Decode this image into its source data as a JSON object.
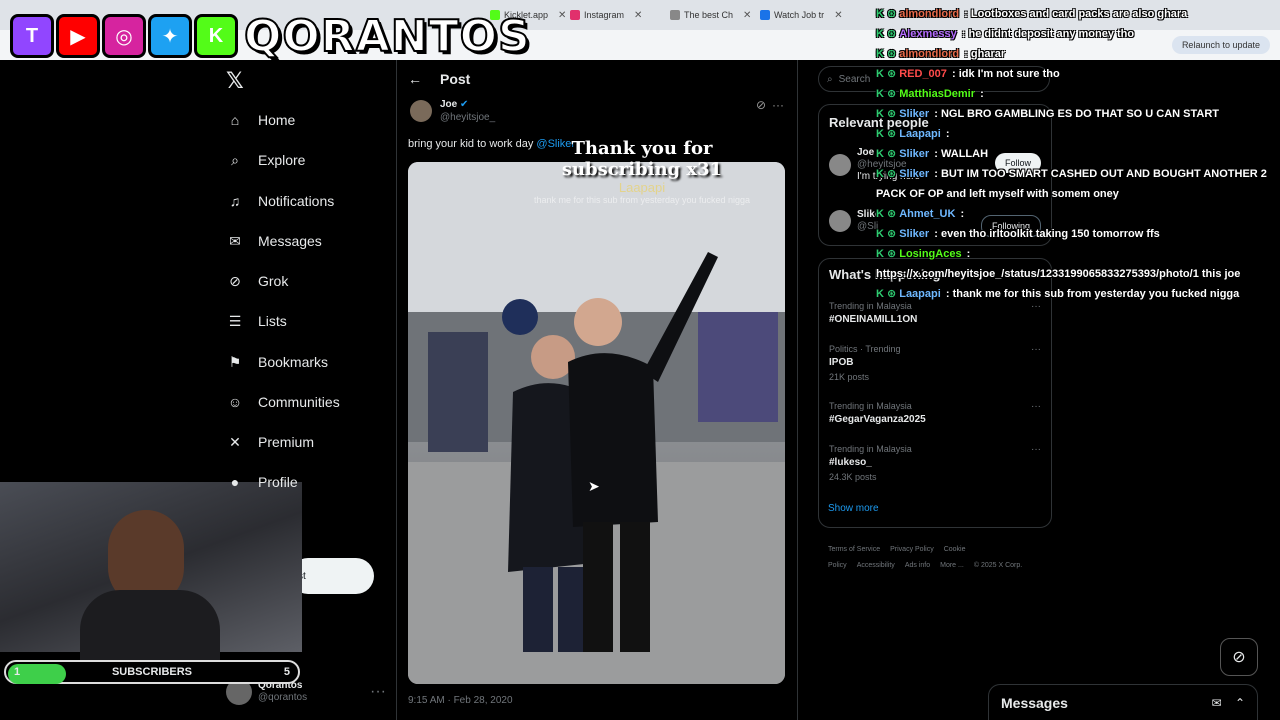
{
  "browser": {
    "tabs": [
      {
        "label": "Kicklet.app",
        "icon": "kick-icon",
        "color": "#53fc18"
      },
      {
        "label": "Instagram",
        "icon": "instagram-icon",
        "color": "#e1306c"
      },
      {
        "label": "The best Ch",
        "icon": "page-icon",
        "color": "#888888"
      },
      {
        "label": "Watch Job tr",
        "icon": "page-icon",
        "color": "#1a73e8"
      }
    ],
    "relaunch_label": "Relaunch to update"
  },
  "overlay": {
    "brand": "QORANTOS",
    "socials": [
      {
        "icon": "twitch-icon",
        "color": "#9146ff",
        "glyph": "T"
      },
      {
        "icon": "youtube-icon",
        "color": "#ff0000",
        "glyph": "▶"
      },
      {
        "icon": "instagram-icon",
        "color": "#d6249f",
        "glyph": "◎"
      },
      {
        "icon": "twitter-bird-icon",
        "color": "#1da1f2",
        "glyph": "✦"
      },
      {
        "icon": "kick-icon",
        "color": "#53fc18",
        "glyph": "K"
      }
    ]
  },
  "nav": {
    "items": [
      {
        "label": "Home",
        "icon": "home-icon",
        "glyph": "⌂"
      },
      {
        "label": "Explore",
        "icon": "search-icon",
        "glyph": "⌕"
      },
      {
        "label": "Notifications",
        "icon": "bell-icon",
        "glyph": "♫"
      },
      {
        "label": "Messages",
        "icon": "mail-icon",
        "glyph": "✉"
      },
      {
        "label": "Grok",
        "icon": "grok-icon",
        "glyph": "⊘"
      },
      {
        "label": "Lists",
        "icon": "list-icon",
        "glyph": "☰"
      },
      {
        "label": "Bookmarks",
        "icon": "bookmark-icon",
        "glyph": "⚑"
      },
      {
        "label": "Communities",
        "icon": "communities-icon",
        "glyph": "☺"
      },
      {
        "label": "Premium",
        "icon": "x-icon",
        "glyph": "✕"
      },
      {
        "label": "Profile",
        "icon": "profile-icon",
        "glyph": "●"
      }
    ],
    "post_button": "st",
    "account": {
      "name": "Qorantos",
      "handle": "@qorantos"
    }
  },
  "post": {
    "header": "Post",
    "author": {
      "name": "Joe",
      "handle": "@heyitsjoe_"
    },
    "text": "bring your kid to work day",
    "mention": "@Sliker",
    "timestamp": "9:15 AM · Feb 28, 2020"
  },
  "sidebar": {
    "search_placeholder": "Search",
    "relevant_title": "Relevant people",
    "people": [
      {
        "name": "Joe",
        "handle": "@heyitsjoe",
        "bio": "I'm trying here",
        "button": "Follow"
      },
      {
        "name": "Slike",
        "handle": "@Sli",
        "bio": "",
        "button": "Following"
      }
    ],
    "happening_title": "What's happening",
    "trends": [
      {
        "context": "Trending in Malaysia",
        "name": "#ONEINAMILL1ON",
        "posts": ""
      },
      {
        "context": "Politics · Trending",
        "name": "IPOB",
        "posts": "21K posts"
      },
      {
        "context": "Trending in Malaysia",
        "name": "#GegarVaganza2025",
        "posts": ""
      },
      {
        "context": "Trending in Malaysia",
        "name": "#lukeso_",
        "posts": "24.3K posts"
      }
    ],
    "show_more": "Show more",
    "footer_links": [
      "Terms of Service",
      "Privacy Policy",
      "Cookie Policy",
      "Accessibility",
      "Ads info",
      "More ...",
      "© 2025 X Corp."
    ],
    "messages_title": "Messages"
  },
  "chat": [
    {
      "user": "almondlord",
      "color": "#e86a4a",
      "msg": "Lootboxes and card packs are also ghara"
    },
    {
      "user": "Alexmessy",
      "color": "#b56cff",
      "msg": "he didnt deposit any money tho"
    },
    {
      "user": "almondlord",
      "color": "#e86a4a",
      "msg": "gharar"
    },
    {
      "user": "RED_007",
      "color": "#ff4b4b",
      "msg": "idk I'm not sure tho"
    },
    {
      "user": "MatthiasDemir",
      "color": "#53fc18",
      "msg": ""
    },
    {
      "user": "Sliker",
      "color": "#6fb8ff",
      "msg": "NGL BRO GAMBLING ES DO THAT SO U CAN START"
    },
    {
      "user": "Laapapi",
      "color": "#6fb8ff",
      "msg": ""
    },
    {
      "user": "Sliker",
      "color": "#6fb8ff",
      "msg": "WALLAH"
    },
    {
      "user": "Sliker",
      "color": "#6fb8ff",
      "msg": "BUT IM TOO SMART CASHED OUT AND BOUGHT ANOTHER 2 PACK OF OP and left myself with somem oney"
    },
    {
      "user": "Ahmet_UK",
      "color": "#6fb8ff",
      "msg": ""
    },
    {
      "user": "Sliker",
      "color": "#6fb8ff",
      "msg": "even tho irltoolkit taking 150 tomorrow ffs"
    },
    {
      "user": "LosingAces",
      "color": "#53fc18",
      "msg": "https://x.com/heyitsjoe_/status/1233199065833275393/photo/1 this joe"
    },
    {
      "user": "Laapapi",
      "color": "#6fb8ff",
      "msg": "thank me for this sub from yesterday you fucked nigga"
    }
  ],
  "sub_alert": {
    "title": "Thank you for subscribing x31",
    "user": "Laapapi",
    "message": "thank me for this sub from yesterday you fucked nigga"
  },
  "sub_goal": {
    "label": "SUBSCRIBERS",
    "current": "1",
    "target": "5",
    "progress": 0.2
  }
}
